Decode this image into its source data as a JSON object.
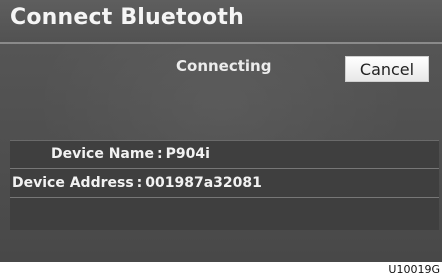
{
  "screen": {
    "title": "Connect Bluetooth",
    "status": "Connecting",
    "cancel_label": "Cancel"
  },
  "device": {
    "name_label": "Device Name",
    "name_value": "P904i",
    "address_label": "Device Address",
    "address_value": "001987a32081",
    "separator": ":"
  },
  "figure": {
    "code": "U10019G"
  },
  "colors": {
    "background": "#525252",
    "panel": "#3f3f3f",
    "button": "#ffffff",
    "text": "#f2f2f2"
  }
}
